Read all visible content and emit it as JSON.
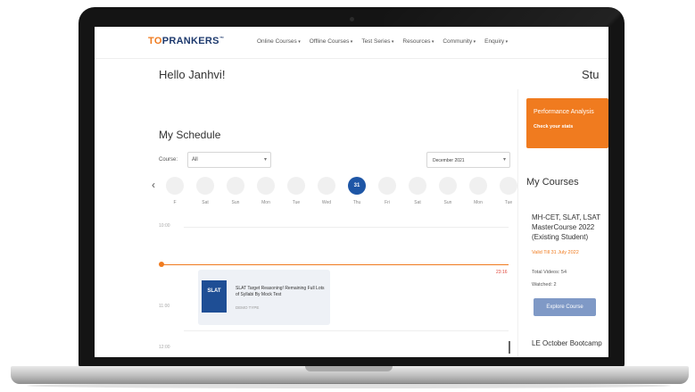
{
  "header": {
    "logo_main": "TOPRANKERS",
    "nav": [
      "Online Courses",
      "Offline Courses",
      "Test Series",
      "Resources",
      "Community",
      "Enquiry"
    ]
  },
  "greeting": "Hello Janhvi!",
  "right_heading_partial": "Stu",
  "schedule": {
    "title": "My Schedule",
    "course_label": "Course:",
    "course_value": "All",
    "month_value": "December 2021",
    "days": [
      {
        "num": "",
        "label": "F"
      },
      {
        "num": "",
        "label": "Sat"
      },
      {
        "num": "",
        "label": "Sun"
      },
      {
        "num": "",
        "label": "Mon"
      },
      {
        "num": "",
        "label": "Tue"
      },
      {
        "num": "",
        "label": "Wed"
      },
      {
        "num": "31",
        "label": "Thu",
        "active": true
      },
      {
        "num": "",
        "label": "Fri"
      },
      {
        "num": "",
        "label": "Sat"
      },
      {
        "num": "",
        "label": "Sun"
      },
      {
        "num": "",
        "label": "Mon"
      },
      {
        "num": "",
        "label": "Tue"
      }
    ],
    "times": [
      "10:00",
      "",
      "11:00",
      "12:00"
    ],
    "now_label": "23:16",
    "event": {
      "thumb_text": "SLAT",
      "title": "SLAT Target Reasoning! Remaining Full Lots of Syllabi By Mock Test",
      "meta": "DEMO TYPE"
    }
  },
  "performance": {
    "title": "Performance Analysis",
    "link": "Check your stats"
  },
  "courses": {
    "title": "My Courses",
    "course_name": "MH-CET, SLAT, LSAT MasterCourse 2022 (Existing Student)",
    "valid": "Valid Till 31 July 2022",
    "videos": "Total Videos: 54",
    "watched": "Watched: 2",
    "explore": "Explore Course",
    "next": "LE October Bootcamp"
  },
  "colors": {
    "brand_blue": "#1e3a6e",
    "accent_orange": "#f07b1f",
    "active_day": "#1e56a6"
  }
}
